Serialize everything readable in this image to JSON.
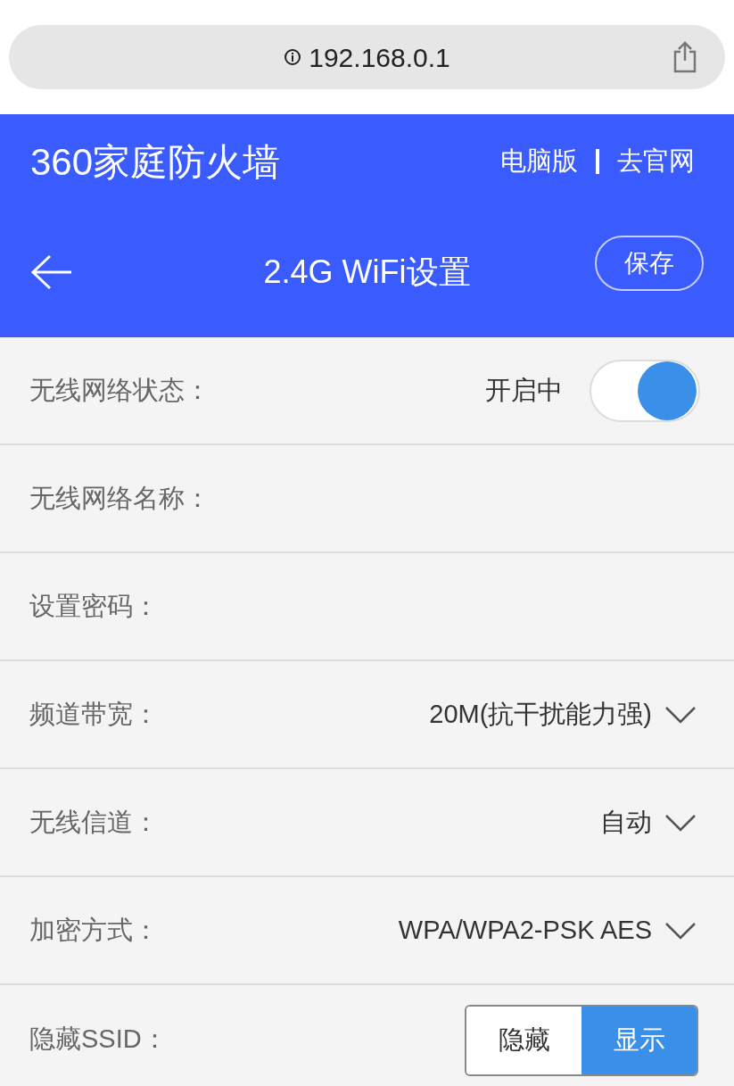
{
  "address_bar": {
    "url": "192.168.0.1"
  },
  "header": {
    "brand": "360家庭防火墙",
    "links": [
      "电脑版",
      "去官网"
    ],
    "title": "2.4G WiFi设置",
    "save_button": "保存"
  },
  "rows": [
    {
      "kind": "toggle",
      "label": "无线网络状态：",
      "status": "开启中",
      "on": true
    },
    {
      "kind": "input",
      "label": "无线网络名称："
    },
    {
      "kind": "input",
      "label": "设置密码："
    },
    {
      "kind": "select",
      "label": "频道带宽：",
      "value": "20M(抗干扰能力强)"
    },
    {
      "kind": "select",
      "label": "无线信道：",
      "value": "自动"
    },
    {
      "kind": "select",
      "label": "加密方式：",
      "value": "WPA/WPA2-PSK AES"
    },
    {
      "kind": "segmented",
      "label": "隐藏SSID：",
      "options": [
        {
          "label": "隐藏",
          "selected": false
        },
        {
          "label": "显示",
          "selected": true
        }
      ]
    }
  ]
}
